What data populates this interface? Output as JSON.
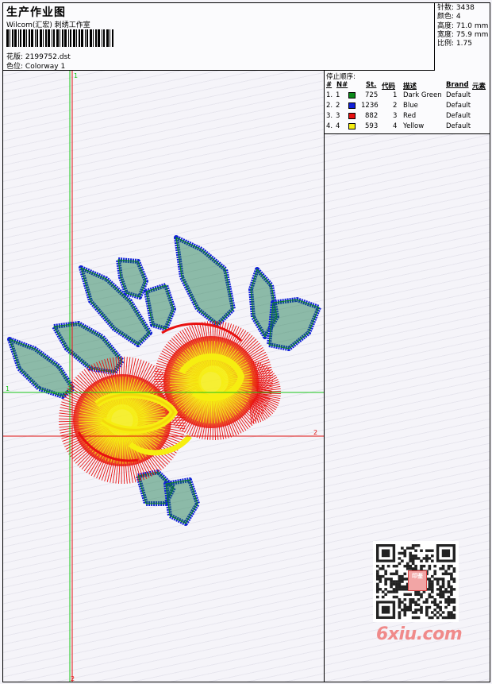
{
  "header": {
    "title": "生产作业图",
    "company": "Wilcom(汇宏) 刺绣工作室",
    "file_label": "花版:",
    "file_name": "2199752.dst",
    "colorway_label": "色位:",
    "colorway_name": "Colorway 1"
  },
  "stats": {
    "stitches_label": "针数:",
    "stitches_value": "3438",
    "colors_label": "颜色:",
    "colors_value": "4",
    "height_label": "高度:",
    "height_value": "71.0 mm",
    "width_label": "宽度:",
    "width_value": "75.9 mm",
    "scale_label": "比例:",
    "scale_value": "1.75"
  },
  "stop_sequence": {
    "title": "停止顺序:",
    "columns": [
      "#",
      "N#",
      "St.",
      "代码",
      "描述",
      "Brand",
      "元素"
    ],
    "rows": [
      {
        "index": "1.",
        "n": "1",
        "stitches": "725",
        "code": "1",
        "description": "Dark Green",
        "brand": "Default",
        "color": "#0b8a1a"
      },
      {
        "index": "2.",
        "n": "2",
        "stitches": "1236",
        "code": "2",
        "description": "Blue",
        "brand": "Default",
        "color": "#1020d8"
      },
      {
        "index": "3.",
        "n": "3",
        "stitches": "882",
        "code": "3",
        "description": "Red",
        "brand": "Default",
        "color": "#e81010"
      },
      {
        "index": "4.",
        "n": "4",
        "stitches": "593",
        "code": "4",
        "description": "Yellow",
        "brand": "Default",
        "color": "#f6ee10"
      }
    ]
  },
  "guides": {
    "v1_label": "1",
    "v2_label": "2",
    "h1_label": "1",
    "h2_label": "2",
    "green": "#19c619",
    "red": "#e01010"
  },
  "qr_stamp": "印鉴",
  "watermark": "6xiu.com"
}
